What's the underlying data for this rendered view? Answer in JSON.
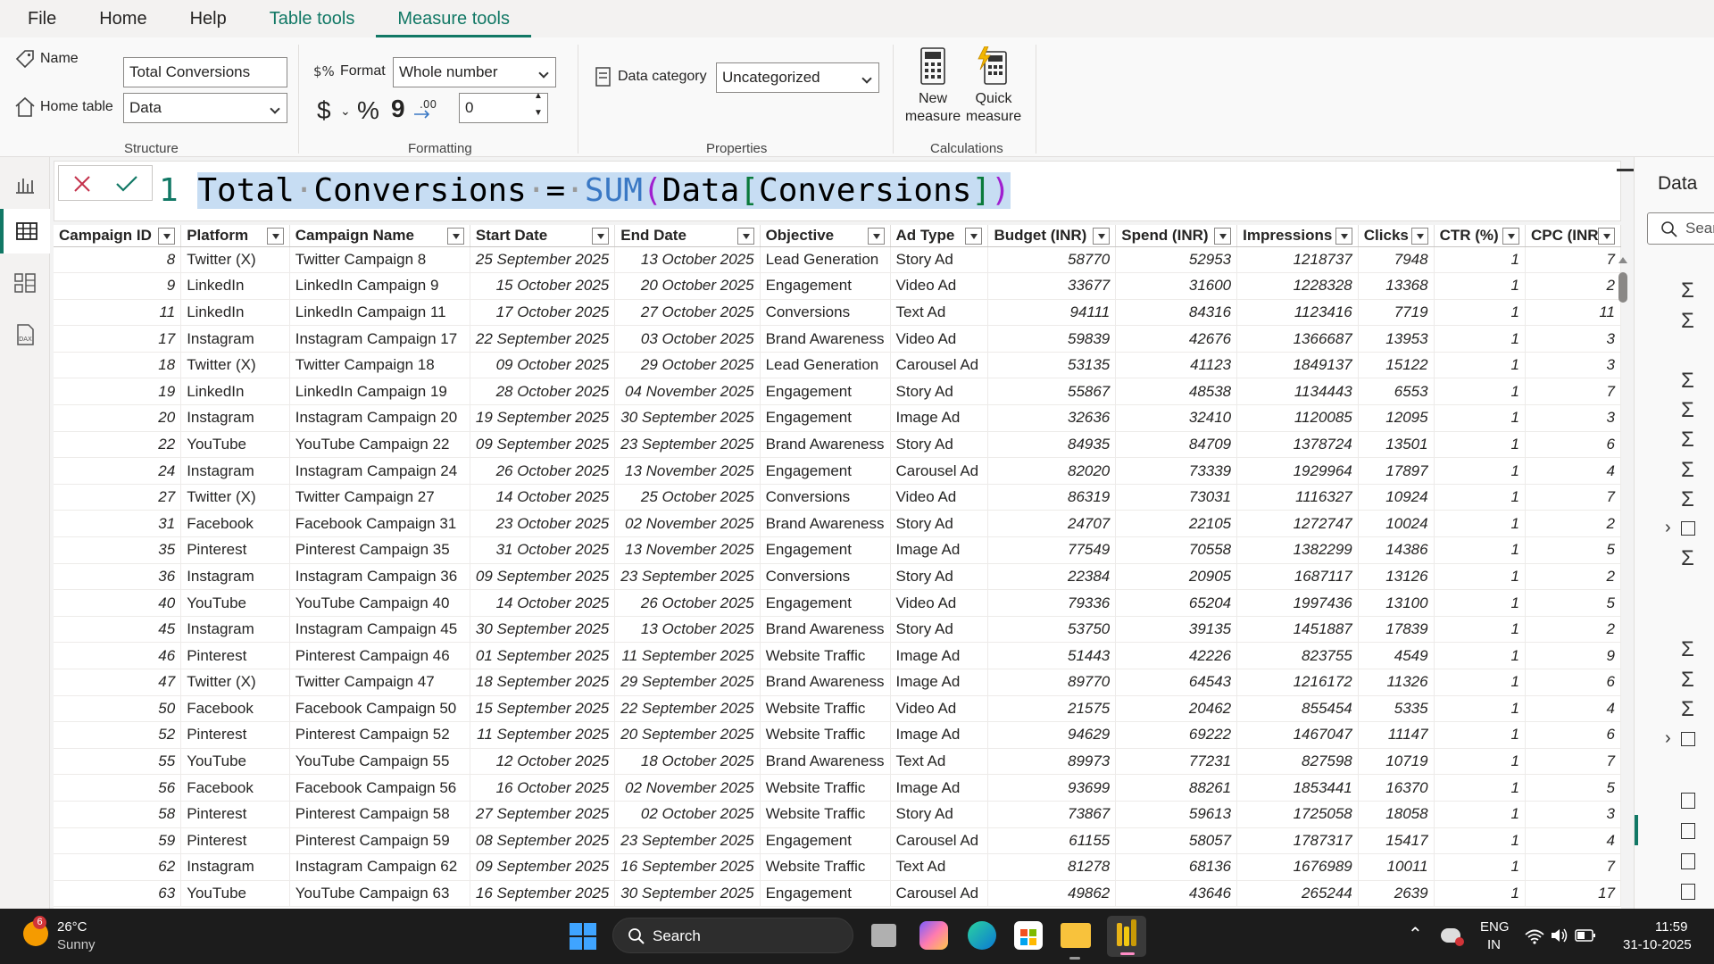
{
  "menu": {
    "items": [
      "File",
      "Home",
      "Help",
      "Table tools",
      "Measure tools"
    ]
  },
  "ribbon": {
    "structure": {
      "name_label": "Name",
      "name_value": "Total Conversions",
      "home_table_label": "Home table",
      "home_table_value": "Data",
      "caption": "Structure"
    },
    "formatting": {
      "format_label": "Format",
      "format_value": "Whole number",
      "currency_symbol": "$",
      "percent_symbol": "%",
      "comma_symbol": "9",
      "decimals_value": "0",
      "caption": "Formatting"
    },
    "properties": {
      "data_category_label": "Data category",
      "data_category_value": "Uncategorized",
      "caption": "Properties"
    },
    "calculations": {
      "new_measure_line1": "New",
      "new_measure_line2": "measure",
      "quick_measure_line1": "Quick",
      "quick_measure_line2": "measure",
      "caption": "Calculations"
    }
  },
  "formula": {
    "line_number": "1",
    "measure_word1": "Total",
    "measure_word2": "Conversions",
    "equals": "=",
    "function": "SUM",
    "open_paren": "(",
    "table": "Data",
    "open_bracket": "[",
    "column": "Conversions",
    "close_bracket": "]",
    "close_paren": ")"
  },
  "right_pane": {
    "title": "Data",
    "search_placeholder": "Sear"
  },
  "table": {
    "columns": [
      "Campaign ID",
      "Platform",
      "Campaign Name",
      "Start Date",
      "End Date",
      "Objective",
      "Ad Type",
      "Budget (INR)",
      "Spend (INR)",
      "Impressions",
      "Clicks",
      "CTR (%)",
      "CPC (INR)"
    ],
    "rows": [
      [
        "8",
        "Twitter (X)",
        "Twitter Campaign 8",
        "25 September 2025",
        "13 October 2025",
        "Lead Generation",
        "Story Ad",
        "58770",
        "52953",
        "1218737",
        "7948",
        "1",
        "7"
      ],
      [
        "9",
        "LinkedIn",
        "LinkedIn Campaign 9",
        "15 October 2025",
        "20 October 2025",
        "Engagement",
        "Video Ad",
        "33677",
        "31600",
        "1228328",
        "13368",
        "1",
        "2"
      ],
      [
        "11",
        "LinkedIn",
        "LinkedIn Campaign 11",
        "17 October 2025",
        "27 October 2025",
        "Conversions",
        "Text Ad",
        "94111",
        "84316",
        "1123416",
        "7719",
        "1",
        "11"
      ],
      [
        "17",
        "Instagram",
        "Instagram Campaign 17",
        "22 September 2025",
        "03 October 2025",
        "Brand Awareness",
        "Video Ad",
        "59839",
        "42676",
        "1366687",
        "13953",
        "1",
        "3"
      ],
      [
        "18",
        "Twitter (X)",
        "Twitter Campaign 18",
        "09 October 2025",
        "29 October 2025",
        "Lead Generation",
        "Carousel Ad",
        "53135",
        "41123",
        "1849137",
        "15122",
        "1",
        "3"
      ],
      [
        "19",
        "LinkedIn",
        "LinkedIn Campaign 19",
        "28 October 2025",
        "04 November 2025",
        "Engagement",
        "Story Ad",
        "55867",
        "48538",
        "1134443",
        "6553",
        "1",
        "7"
      ],
      [
        "20",
        "Instagram",
        "Instagram Campaign 20",
        "19 September 2025",
        "30 September 2025",
        "Engagement",
        "Image Ad",
        "32636",
        "32410",
        "1120085",
        "12095",
        "1",
        "3"
      ],
      [
        "22",
        "YouTube",
        "YouTube Campaign 22",
        "09 September 2025",
        "23 September 2025",
        "Brand Awareness",
        "Story Ad",
        "84935",
        "84709",
        "1378724",
        "13501",
        "1",
        "6"
      ],
      [
        "24",
        "Instagram",
        "Instagram Campaign 24",
        "26 October 2025",
        "13 November 2025",
        "Engagement",
        "Carousel Ad",
        "82020",
        "73339",
        "1929964",
        "17897",
        "1",
        "4"
      ],
      [
        "27",
        "Twitter (X)",
        "Twitter Campaign 27",
        "14 October 2025",
        "25 October 2025",
        "Conversions",
        "Video Ad",
        "86319",
        "73031",
        "1116327",
        "10924",
        "1",
        "7"
      ],
      [
        "31",
        "Facebook",
        "Facebook Campaign 31",
        "23 October 2025",
        "02 November 2025",
        "Brand Awareness",
        "Story Ad",
        "24707",
        "22105",
        "1272747",
        "10024",
        "1",
        "2"
      ],
      [
        "35",
        "Pinterest",
        "Pinterest Campaign 35",
        "31 October 2025",
        "13 November 2025",
        "Engagement",
        "Image Ad",
        "77549",
        "70558",
        "1382299",
        "14386",
        "1",
        "5"
      ],
      [
        "36",
        "Instagram",
        "Instagram Campaign 36",
        "09 September 2025",
        "23 September 2025",
        "Conversions",
        "Story Ad",
        "22384",
        "20905",
        "1687117",
        "13126",
        "1",
        "2"
      ],
      [
        "40",
        "YouTube",
        "YouTube Campaign 40",
        "14 October 2025",
        "26 October 2025",
        "Engagement",
        "Video Ad",
        "79336",
        "65204",
        "1997436",
        "13100",
        "1",
        "5"
      ],
      [
        "45",
        "Instagram",
        "Instagram Campaign 45",
        "30 September 2025",
        "13 October 2025",
        "Brand Awareness",
        "Story Ad",
        "53750",
        "39135",
        "1451887",
        "17839",
        "1",
        "2"
      ],
      [
        "46",
        "Pinterest",
        "Pinterest Campaign 46",
        "01 September 2025",
        "11 September 2025",
        "Website Traffic",
        "Image Ad",
        "51443",
        "42226",
        "823755",
        "4549",
        "1",
        "9"
      ],
      [
        "47",
        "Twitter (X)",
        "Twitter Campaign 47",
        "18 September 2025",
        "29 September 2025",
        "Brand Awareness",
        "Image Ad",
        "89770",
        "64543",
        "1216172",
        "11326",
        "1",
        "6"
      ],
      [
        "50",
        "Facebook",
        "Facebook Campaign 50",
        "15 September 2025",
        "22 September 2025",
        "Website Traffic",
        "Video Ad",
        "21575",
        "20462",
        "855454",
        "5335",
        "1",
        "4"
      ],
      [
        "52",
        "Pinterest",
        "Pinterest Campaign 52",
        "11 September 2025",
        "20 September 2025",
        "Website Traffic",
        "Image Ad",
        "94629",
        "69222",
        "1467047",
        "11147",
        "1",
        "6"
      ],
      [
        "55",
        "YouTube",
        "YouTube Campaign 55",
        "12 October 2025",
        "18 October 2025",
        "Brand Awareness",
        "Text Ad",
        "89973",
        "77231",
        "827598",
        "10719",
        "1",
        "7"
      ],
      [
        "56",
        "Facebook",
        "Facebook Campaign 56",
        "16 October 2025",
        "02 November 2025",
        "Website Traffic",
        "Image Ad",
        "93699",
        "88261",
        "1853441",
        "16370",
        "1",
        "5"
      ],
      [
        "58",
        "Pinterest",
        "Pinterest Campaign 58",
        "27 September 2025",
        "02 October 2025",
        "Website Traffic",
        "Story Ad",
        "73867",
        "59613",
        "1725058",
        "18058",
        "1",
        "3"
      ],
      [
        "59",
        "Pinterest",
        "Pinterest Campaign 59",
        "08 September 2025",
        "23 September 2025",
        "Engagement",
        "Carousel Ad",
        "61155",
        "58057",
        "1787317",
        "15417",
        "1",
        "4"
      ],
      [
        "62",
        "Instagram",
        "Instagram Campaign 62",
        "09 September 2025",
        "16 September 2025",
        "Website Traffic",
        "Text Ad",
        "81278",
        "68136",
        "1676989",
        "10011",
        "1",
        "7"
      ],
      [
        "63",
        "YouTube",
        "YouTube Campaign 63",
        "16 September 2025",
        "30 September 2025",
        "Engagement",
        "Carousel Ad",
        "49862",
        "43646",
        "265244",
        "2639",
        "1",
        "17"
      ]
    ]
  },
  "taskbar": {
    "weather_badge": "6",
    "temperature": "26°C",
    "condition": "Sunny",
    "search_label": "Search",
    "lang_line1": "ENG",
    "lang_line2": "IN",
    "time": "11:59",
    "date": "31-10-2025"
  },
  "colors": {
    "accent": "#117865",
    "selection": "#c7ddf3",
    "function": "#3a78c4",
    "taskbar": "#1c1c1c"
  }
}
